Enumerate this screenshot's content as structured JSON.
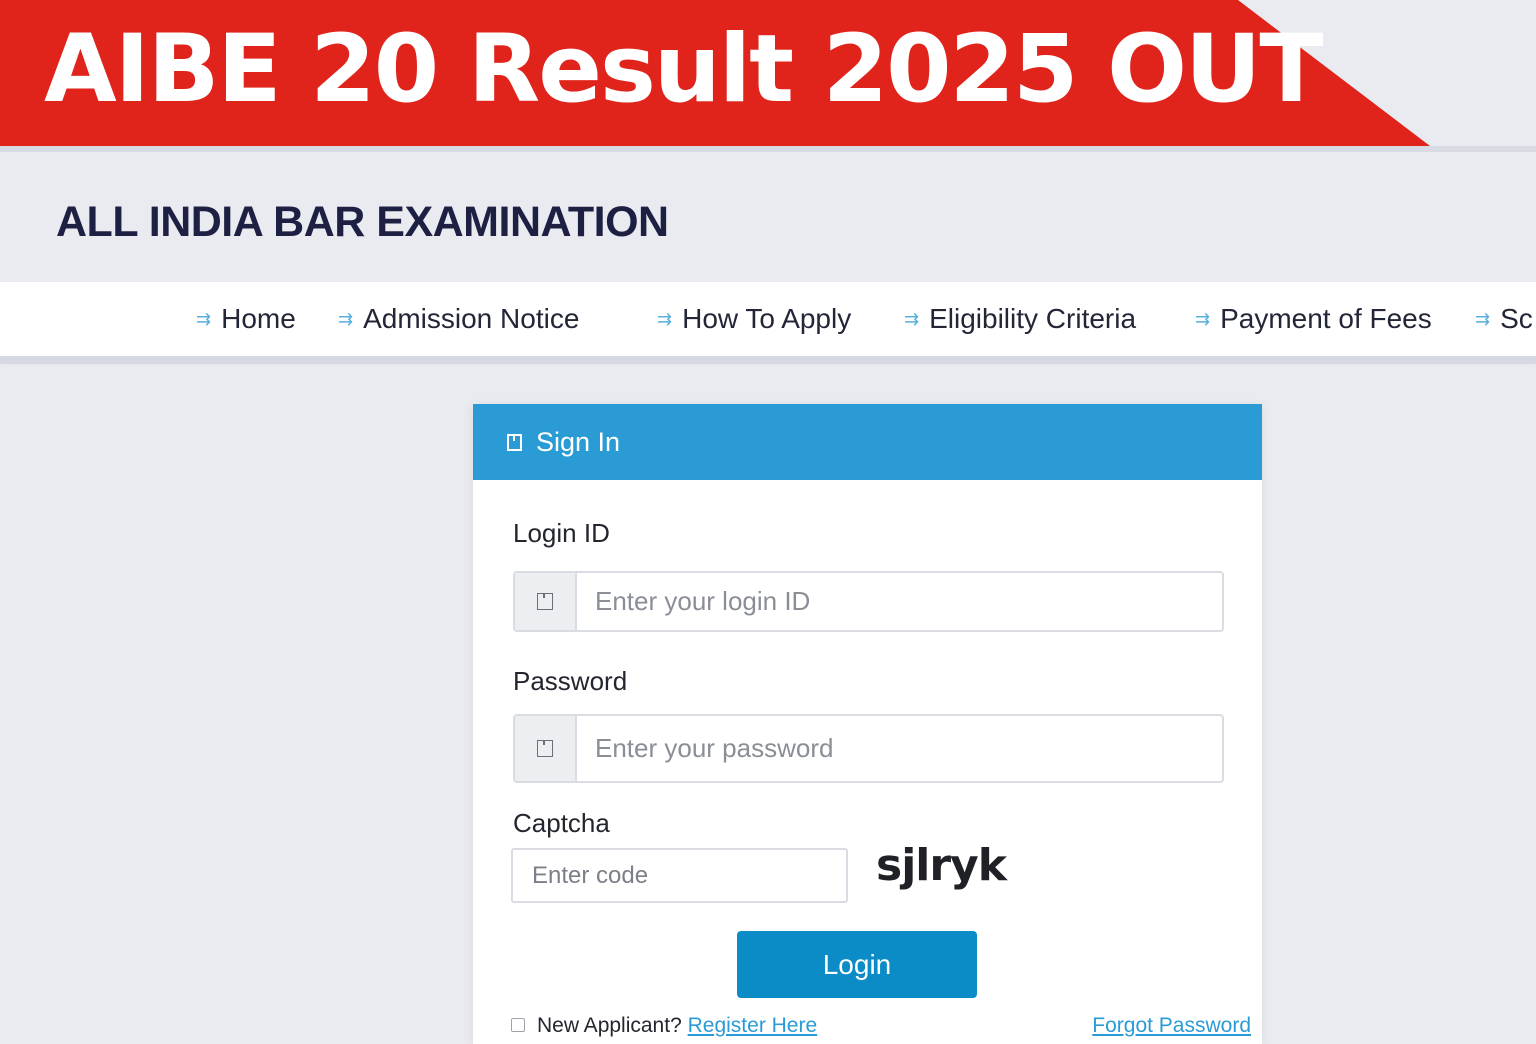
{
  "banner": {
    "title": "AIBE 20 Result 2025 OUT",
    "color": "#e0231b"
  },
  "site": {
    "title": "ALL INDIA BAR EXAMINATION"
  },
  "nav": {
    "items": [
      {
        "label": "Home",
        "icon": "double-arrow-icon"
      },
      {
        "label": "Admission Notice",
        "icon": "double-arrow-icon"
      },
      {
        "label": "How To Apply",
        "icon": "double-arrow-icon"
      },
      {
        "label": "Eligibility Criteria",
        "icon": "double-arrow-icon"
      },
      {
        "label": "Payment of Fees",
        "icon": "double-arrow-icon"
      },
      {
        "label": "Sc",
        "icon": "double-arrow-icon"
      }
    ]
  },
  "signin": {
    "header_title": "Sign In",
    "header_color": "#2b9bd6",
    "login_id": {
      "label": "Login ID",
      "placeholder": "Enter your login ID",
      "value": ""
    },
    "password": {
      "label": "Password",
      "placeholder": "Enter your password",
      "value": ""
    },
    "captcha": {
      "label": "Captcha",
      "placeholder": "Enter code",
      "value": "",
      "code": "sjlryk"
    },
    "login_button": "Login",
    "login_button_color": "#0b8cc7",
    "new_applicant_text": "New Applicant?",
    "register_link": "Register Here",
    "forgot_link": "Forgot Password"
  }
}
